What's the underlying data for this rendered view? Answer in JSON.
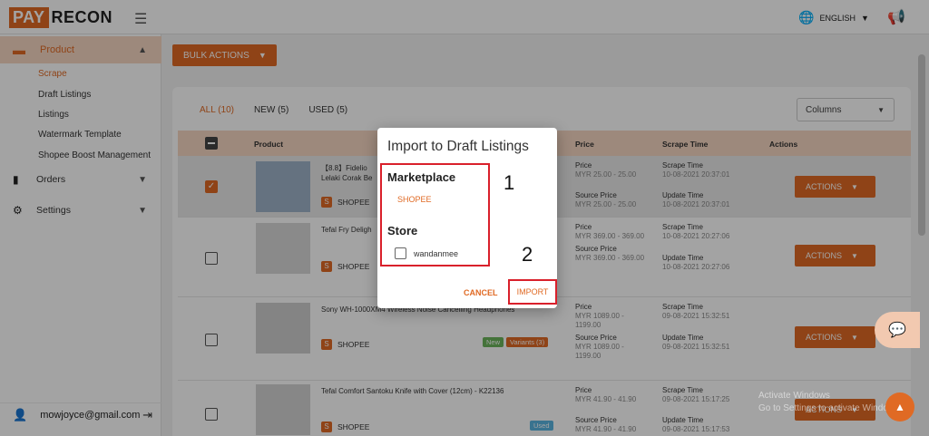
{
  "brand": {
    "pay": "PAY",
    "recon": "RECON"
  },
  "topbar": {
    "language": "ENGLISH"
  },
  "sidebar": {
    "product_label": "Product",
    "sub_items": [
      "Scrape",
      "Draft Listings",
      "Listings",
      "Watermark Template",
      "Shopee Boost Management"
    ],
    "orders_label": "Orders",
    "settings_label": "Settings",
    "user_email": "mowjoyce@gmail.com"
  },
  "main": {
    "bulk_actions": "BULK ACTIONS",
    "tabs": [
      "ALL (10)",
      "NEW (5)",
      "USED (5)"
    ],
    "columns_select": "Columns",
    "headers": {
      "product": "Product",
      "price": "Price",
      "scrape_time": "Scrape Time",
      "actions": "Actions"
    },
    "rows": [
      {
        "name": "【8.8】Fidelio \nLelaki Corak Be",
        "shop": "SHOPEE",
        "price_label": "Price",
        "price": "MYR 25.00 - 25.00",
        "source_label": "Source Price",
        "source": "MYR 25.00 - 25.00",
        "scrape_label": "Scrape Time",
        "scrape": "10-08-2021 20:37:01",
        "update_label": "Update Time",
        "update": "10-08-2021 20:37:01",
        "action": "ACTIONS",
        "checked": true
      },
      {
        "name": "Tefal Fry Deligh",
        "shop": "SHOPEE",
        "price_label": "Price",
        "price": "MYR 369.00 - 369.00",
        "source_label": "Source Price",
        "source": "MYR 369.00 - 369.00",
        "scrape_label": "Scrape Time",
        "scrape": "10-08-2021 20:27:06",
        "update_label": "Update Time",
        "update": "10-08-2021 20:27:06",
        "action": "ACTIONS",
        "checked": false
      },
      {
        "name": "Sony WH-1000XM4 Wireless Noise Cancelling Headphones",
        "shop": "SHOPEE",
        "badge1": "New",
        "badge2": "Variants (3)",
        "price_label": "Price",
        "price": "MYR 1089.00 - 1199.00",
        "source_label": "Source Price",
        "source": "MYR 1089.00 - 1199.00",
        "scrape_label": "Scrape Time",
        "scrape": "09-08-2021 15:32:51",
        "update_label": "Update Time",
        "update": "09-08-2021 15:32:51",
        "action": "ACTIONS",
        "checked": false
      },
      {
        "name": "Tefal Comfort Santoku Knife with Cover (12cm) - K22136",
        "shop": "SHOPEE",
        "badge1": "Used",
        "price_label": "Price",
        "price": "MYR 41.90 - 41.90",
        "source_label": "Source Price",
        "source": "MYR 41.90 - 41.90",
        "scrape_label": "Scrape Time",
        "scrape": "09-08-2021 15:17:25",
        "update_label": "Update Time",
        "update": "09-08-2021 15:17:53",
        "action": "ACTIONS",
        "checked": false
      }
    ]
  },
  "modal": {
    "title": "Import to Draft Listings",
    "marketplace_label": "Marketplace",
    "marketplace_value": "SHOPEE",
    "store_label": "Store",
    "store_name": "wandanmee",
    "cancel": "CANCEL",
    "import": "IMPORT"
  },
  "annotations": {
    "step1": "1",
    "step2": "2"
  },
  "watermark": {
    "line1": "Activate Windows",
    "line2": "Go to Settings to activate Windows."
  },
  "colors": {
    "accent": "#e06a24",
    "highlight": "#d9202b"
  }
}
